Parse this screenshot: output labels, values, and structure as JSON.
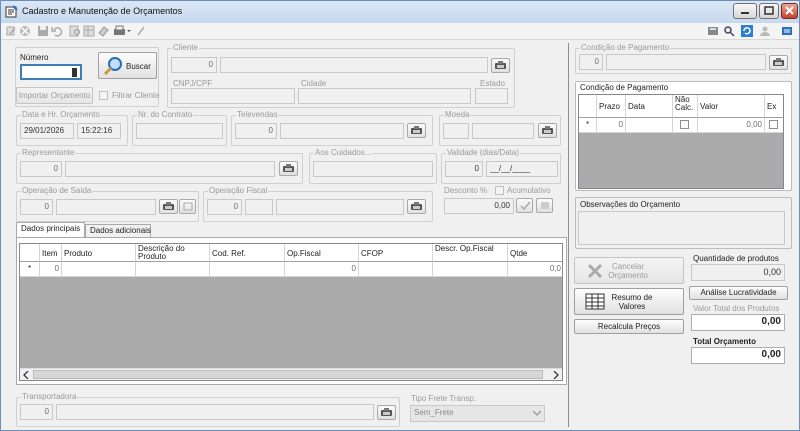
{
  "window": {
    "title": "Cadastro e Manutenção de Orçamentos"
  },
  "search": {
    "numero_label": "Número",
    "numero_value": "",
    "buscar_label": "Buscar",
    "importar_label": "Importar Orçamento",
    "filtrar_label": "Filtrar Cliente"
  },
  "cliente": {
    "group": "Cliente",
    "code": "0",
    "name": "",
    "cnpj_label": "CNPJ/CPF",
    "cidade_label": "Cidade",
    "estado_label": "Estado"
  },
  "data_hora": {
    "group": "Data e Hr. Orçamento",
    "date": "29/01/2026",
    "time": "15:22:16"
  },
  "contrato": {
    "group": "Nr. do Contrato",
    "value": ""
  },
  "televendas": {
    "group": "Televendas",
    "code": "0",
    "name": ""
  },
  "moeda": {
    "group": "Moeda",
    "code": "",
    "name": ""
  },
  "representante": {
    "group": "Representante",
    "code": "0",
    "name": ""
  },
  "aos_cuidados": {
    "group": "Aos Cuidados...",
    "value": ""
  },
  "validade": {
    "group": "Validade (dias/Data)",
    "days": "0",
    "date": "__/__/____"
  },
  "op_saida": {
    "group": "Operação de Saída",
    "code": "0",
    "name": ""
  },
  "op_fiscal": {
    "group": "Operação Fiscal",
    "code": "0",
    "sub": "",
    "name": ""
  },
  "desconto": {
    "label": "Desconto %",
    "acumulativo_label": "Acumulativo",
    "value": "0,00"
  },
  "tabs": [
    {
      "label": "Dados principais"
    },
    {
      "label": "Dados adicionais"
    }
  ],
  "items_grid": {
    "columns": [
      "Item",
      "Produto",
      "Descrição do Produto",
      "Cod. Ref.",
      "Op.Fiscal",
      "CFOP",
      "Descr. Op.Fiscal",
      "Qtde"
    ],
    "row": {
      "marker": "*",
      "item": "0",
      "produto": "",
      "descricao": "",
      "cod_ref": "",
      "op_fiscal": "0",
      "cfop": "",
      "descr_op": "",
      "qtde": "0,0"
    }
  },
  "transportadora": {
    "group": "Transportadora",
    "code": "0",
    "name": ""
  },
  "frete": {
    "group": "Tipo Frete Transp.",
    "value": "Sem_Frete"
  },
  "cond_pag_top": {
    "group": "Condição de Pagamento",
    "code": "0",
    "name": ""
  },
  "cond_pag_grid": {
    "group": "Condição de Pagamento",
    "columns": [
      "Prazo",
      "Data",
      "Não Calc.",
      "Valor",
      "Ex"
    ],
    "row": {
      "marker": "*",
      "prazo": "0",
      "data": "",
      "valor": "0,00"
    }
  },
  "observacoes": {
    "group": "Observações do Orçamento",
    "value": ""
  },
  "actions": {
    "cancelar": "Cancelar Orçamento",
    "resumo": "Resumo de Valores",
    "recalcula": "Recalcula Preços",
    "analise": "Análise Lucratividade"
  },
  "totals": {
    "qtd_label": "Quantidade de produtos",
    "qtd_value": "0,00",
    "valor_label": "Valor Total dos Produtos",
    "valor_value": "0,00",
    "total_label": "Total Orçamento",
    "total_value": "0,00"
  }
}
